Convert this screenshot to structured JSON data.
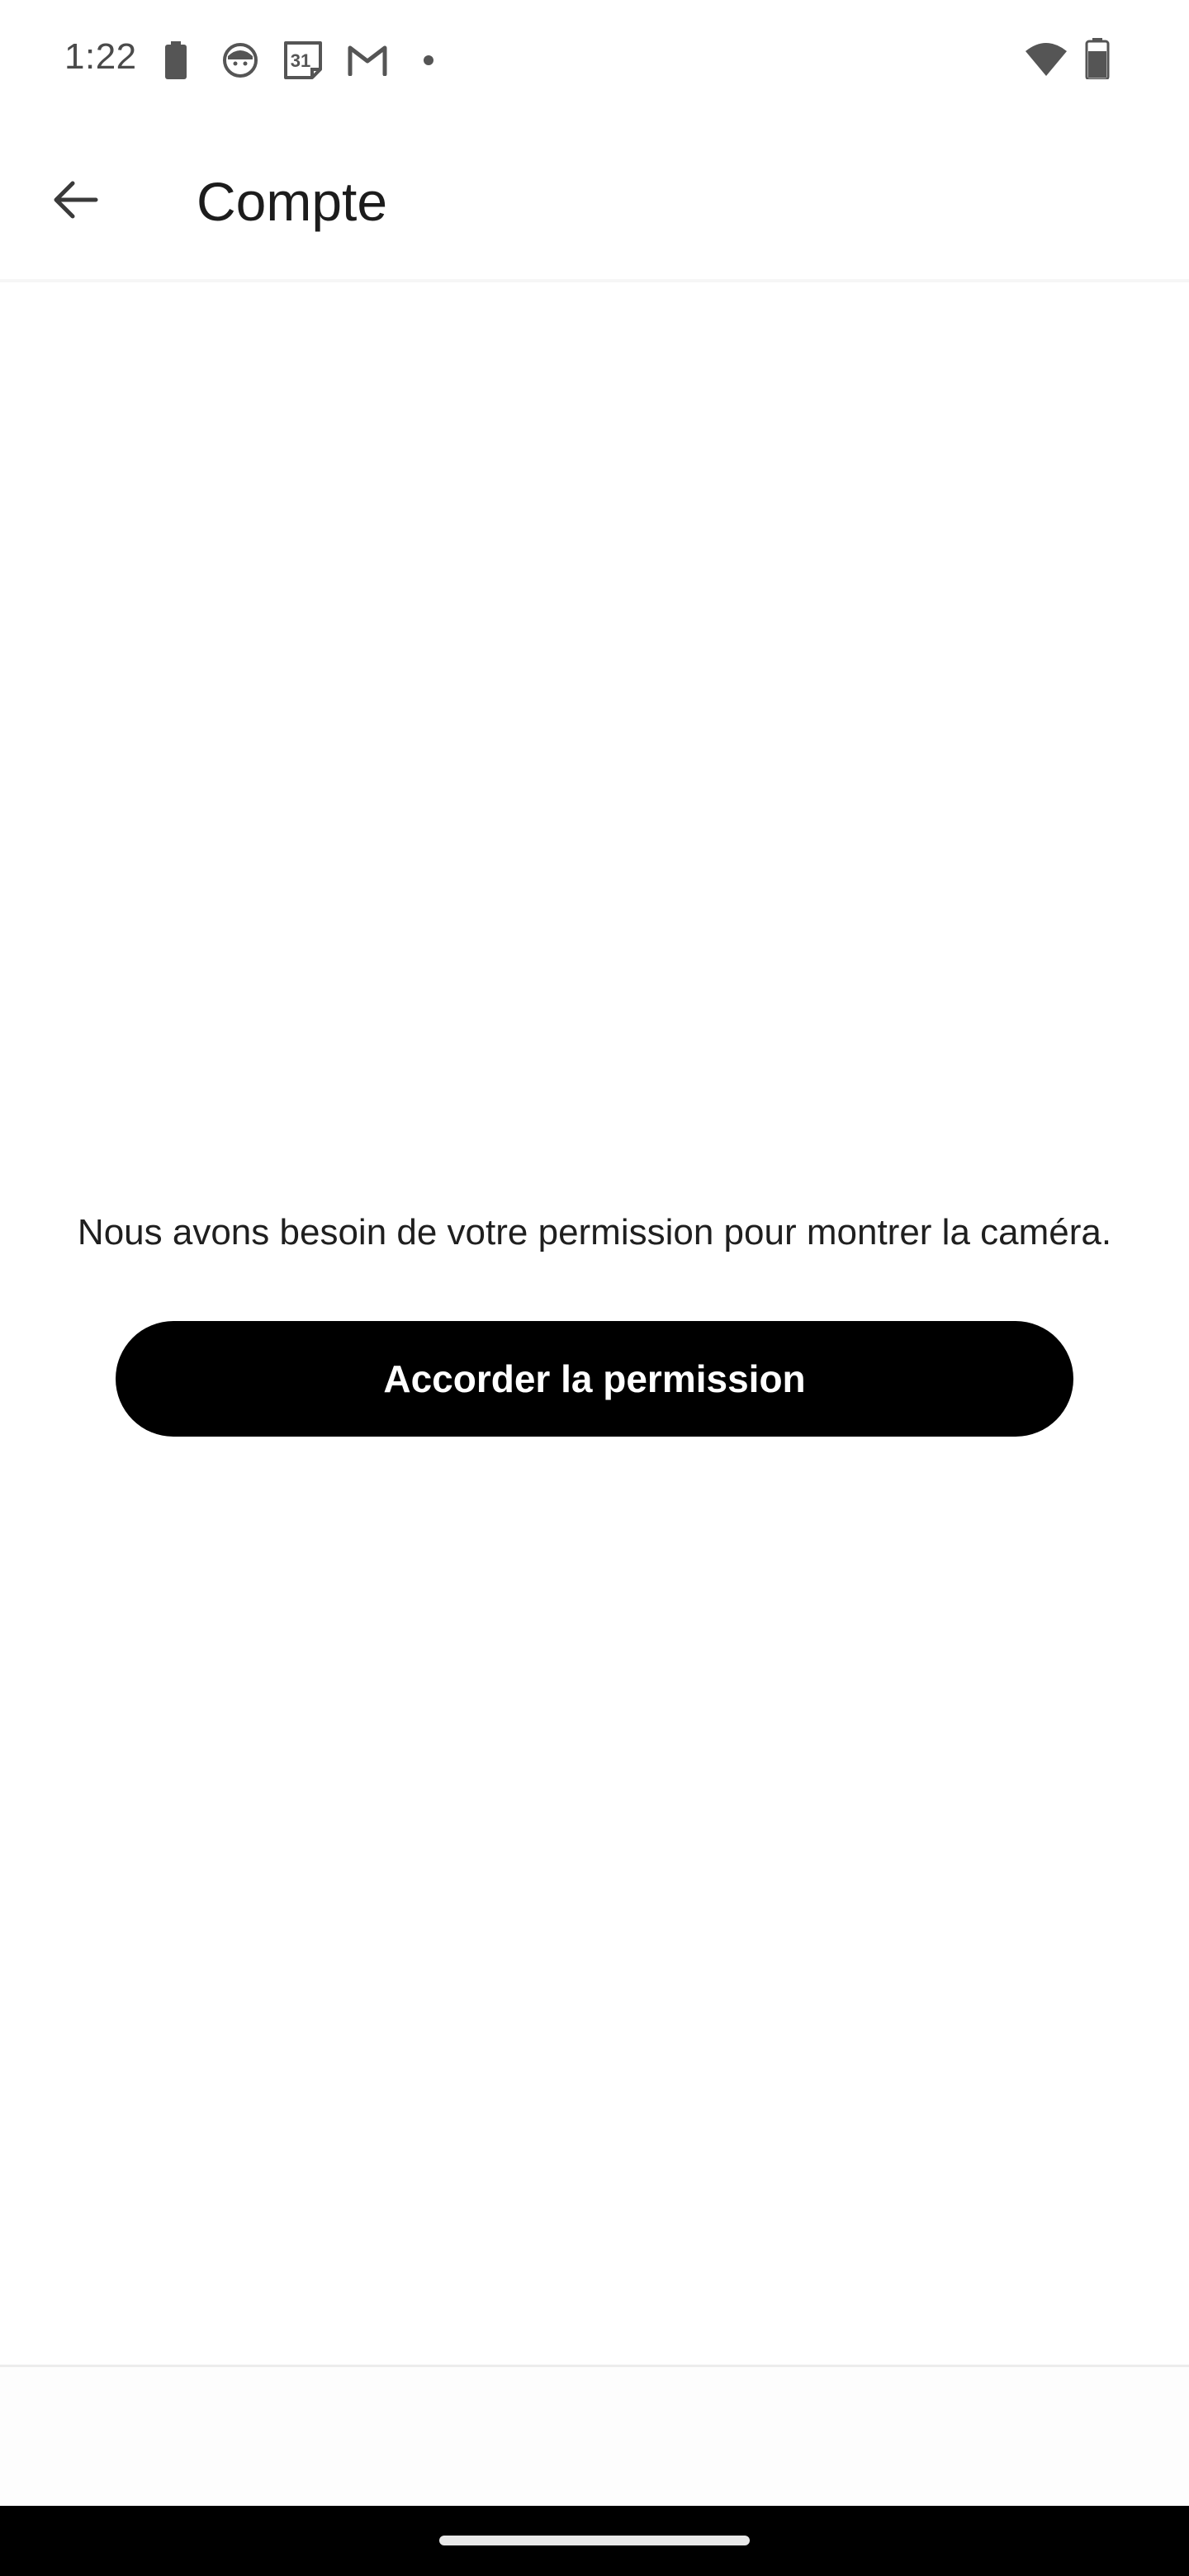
{
  "status_bar": {
    "time": "1:22",
    "left_icons": [
      "battery-saver-icon",
      "face-app-icon",
      "calendar-icon",
      "gmail-icon",
      "notification-dot-icon"
    ],
    "calendar_day": "31",
    "right_icons": [
      "wifi-icon",
      "battery-icon"
    ]
  },
  "app_bar": {
    "title": "Compte",
    "back_icon": "arrow-left-icon"
  },
  "content": {
    "message": "Nous avons besoin de votre permission pour montrer la caméra.",
    "grant_button_label": "Accorder la permission"
  },
  "colors": {
    "button_bg": "#000000",
    "button_text": "#ffffff",
    "background": "#ffffff",
    "nav_bar": "#000000"
  }
}
